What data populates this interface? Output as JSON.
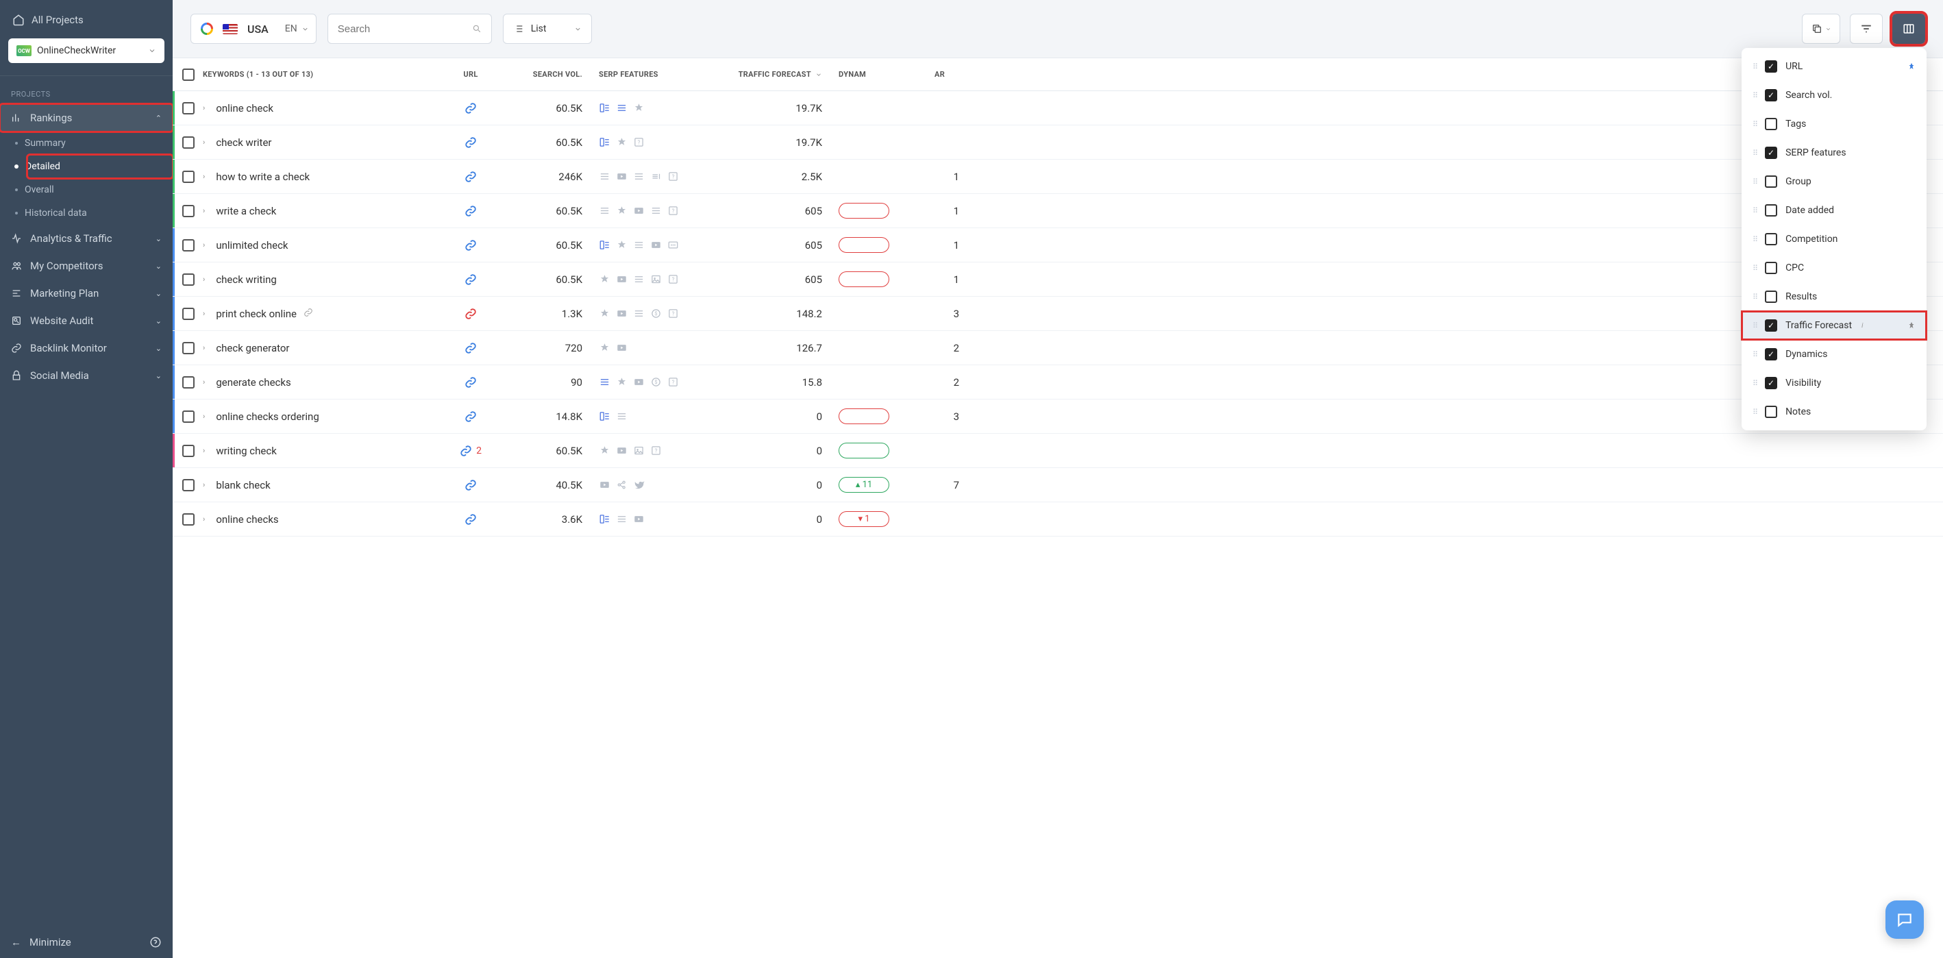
{
  "sidebar": {
    "allProjects": "All Projects",
    "projectName": "OnlineCheckWriter",
    "sectionLabel": "PROJECTS",
    "nav": {
      "rankings": "Rankings",
      "summary": "Summary",
      "detailed": "Detailed",
      "overall": "Overall",
      "historical": "Historical data",
      "analytics": "Analytics & Traffic",
      "competitors": "My Competitors",
      "marketing": "Marketing Plan",
      "audit": "Website Audit",
      "backlink": "Backlink Monitor",
      "social": "Social Media"
    },
    "minimize": "Minimize"
  },
  "toolbar": {
    "country": "USA",
    "lang": "EN",
    "searchPlaceholder": "Search",
    "viewMode": "List"
  },
  "table": {
    "headerKeywords": "KEYWORDS (1 - 13 OUT OF 13)",
    "headerUrl": "URL",
    "headerVol": "SEARCH VOL.",
    "headerSerp": "SERP FEATURES",
    "headerForecast": "TRAFFIC FORECAST",
    "headerDynamics": "DYNAM",
    "headerX": "AR"
  },
  "rows": [
    {
      "bar": "green",
      "kw": "online check",
      "vol": "60.5K",
      "forecast": "19.7K",
      "urlColor": "blue",
      "urlExtra": "",
      "dyn": null,
      "x": "",
      "serp": [
        "feat-blue",
        "list-blue",
        "star-gray"
      ]
    },
    {
      "bar": "green",
      "kw": "check writer",
      "vol": "60.5K",
      "forecast": "19.7K",
      "urlColor": "blue",
      "urlExtra": "",
      "dyn": null,
      "x": "",
      "serp": [
        "feat-blue",
        "star-gray",
        "box-gray"
      ]
    },
    {
      "bar": "green",
      "kw": "how to write a check",
      "vol": "246K",
      "forecast": "2.5K",
      "urlColor": "blue",
      "urlExtra": "",
      "dyn": null,
      "x": "1",
      "serp": [
        "list-gray",
        "vid-gray",
        "list-gray",
        "stack-gray",
        "box-gray"
      ]
    },
    {
      "bar": "green",
      "kw": "write a check",
      "vol": "60.5K",
      "forecast": "605",
      "urlColor": "blue",
      "urlExtra": "",
      "dyn": {
        "c": "red"
      },
      "x": "1",
      "serp": [
        "list-gray",
        "star-gray",
        "vid-gray",
        "list-gray",
        "box-gray"
      ]
    },
    {
      "bar": "blue",
      "kw": "unlimited check",
      "vol": "60.5K",
      "forecast": "605",
      "urlColor": "blue",
      "urlExtra": "",
      "dyn": {
        "c": "red"
      },
      "x": "1",
      "serp": [
        "feat-blue",
        "star-gray",
        "list-gray",
        "vid-gray",
        "more-gray"
      ]
    },
    {
      "bar": "blue",
      "kw": "check writing",
      "vol": "60.5K",
      "forecast": "605",
      "urlColor": "blue",
      "urlExtra": "",
      "dyn": {
        "c": "red"
      },
      "x": "1",
      "serp": [
        "star-gray",
        "vid-gray",
        "list-gray",
        "img-gray",
        "box-gray"
      ]
    },
    {
      "bar": "blue",
      "kw": "print check online",
      "vol": "1.3K",
      "forecast": "148.2",
      "urlColor": "red",
      "urlExtra": "",
      "dyn": null,
      "x": "3",
      "serp": [
        "star-gray",
        "vid-gray",
        "list-gray",
        "money-gray",
        "box-gray"
      ],
      "linkIcon": true
    },
    {
      "bar": "blue",
      "kw": "check generator",
      "vol": "720",
      "forecast": "126.7",
      "urlColor": "blue",
      "urlExtra": "",
      "dyn": null,
      "x": "2",
      "serp": [
        "star-gray",
        "vid-gray"
      ]
    },
    {
      "bar": "blue",
      "kw": "generate checks",
      "vol": "90",
      "forecast": "15.8",
      "urlColor": "blue",
      "urlExtra": "",
      "dyn": null,
      "x": "2",
      "serp": [
        "list-blue",
        "star-gray",
        "vid-gray",
        "money-gray",
        "box-gray"
      ]
    },
    {
      "bar": "blue",
      "kw": "online checks ordering",
      "vol": "14.8K",
      "forecast": "0",
      "urlColor": "blue",
      "urlExtra": "",
      "dyn": {
        "c": "red"
      },
      "x": "3",
      "serp": [
        "feat-blue",
        "list-gray"
      ]
    },
    {
      "bar": "pink",
      "kw": "writing check",
      "vol": "60.5K",
      "forecast": "0",
      "urlColor": "blue",
      "urlExtra": "2",
      "dyn": {
        "c": "green"
      },
      "x": "",
      "serp": [
        "star-gray",
        "vid-gray",
        "img-gray",
        "box-gray"
      ]
    },
    {
      "bar": "",
      "kw": "blank check",
      "vol": "40.5K",
      "forecast": "0",
      "urlColor": "blue",
      "urlExtra": "",
      "dyn": {
        "c": "green",
        "v": "11"
      },
      "x": "7",
      "serp": [
        "vid-gray",
        "share-gray",
        "bird-gray"
      ]
    },
    {
      "bar": "",
      "kw": "online checks",
      "vol": "3.6K",
      "forecast": "0",
      "urlColor": "blue",
      "urlExtra": "",
      "dyn": {
        "c": "red",
        "v": "1"
      },
      "x": "",
      "serp": [
        "feat-blue",
        "list-gray",
        "vid-gray"
      ]
    }
  ],
  "columnChooser": [
    {
      "label": "URL",
      "checked": true,
      "pin": true
    },
    {
      "label": "Search vol.",
      "checked": true
    },
    {
      "label": "Tags",
      "checked": false
    },
    {
      "label": "SERP features",
      "checked": true
    },
    {
      "label": "Group",
      "checked": false
    },
    {
      "label": "Date added",
      "checked": false
    },
    {
      "label": "Competition",
      "checked": false
    },
    {
      "label": "CPC",
      "checked": false
    },
    {
      "label": "Results",
      "checked": false
    },
    {
      "label": "Traffic Forecast",
      "checked": true,
      "info": true,
      "highlighted": true,
      "pinGray": true
    },
    {
      "label": "Dynamics",
      "checked": true
    },
    {
      "label": "Visibility",
      "checked": true
    },
    {
      "label": "Notes",
      "checked": false
    }
  ]
}
